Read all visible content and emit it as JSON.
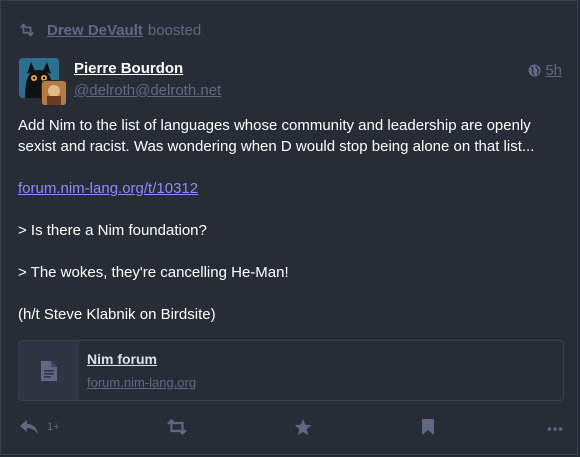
{
  "boost": {
    "booster": "Drew DeVault",
    "label": "boosted"
  },
  "author": {
    "display_name": "Pierre Bourdon",
    "handle": "@delroth@delroth.net"
  },
  "meta": {
    "visibility_icon": "globe-icon",
    "time": "5h"
  },
  "content": {
    "paragraphs": [
      "Add Nim to the list of languages whose community and leadership are openly sexist and racist. Was wondering when D would stop being alone on that list...",
      "forum.nim-lang.org/t/10312",
      "> Is there a Nim foundation?",
      "> The wokes, they're cancelling He-Man!",
      "(h/t Steve Klabnik on Birdsite)"
    ]
  },
  "card": {
    "title": "Nim forum",
    "url": "forum.nim-lang.org",
    "icon": "file-icon"
  },
  "actions": {
    "reply_count": "1+",
    "icons": [
      "reply-icon",
      "boost-icon",
      "star-icon",
      "bookmark-icon",
      "more-icon"
    ]
  },
  "colors": {
    "background": "#282c37",
    "muted": "#606984",
    "link": "#8c8dff"
  }
}
